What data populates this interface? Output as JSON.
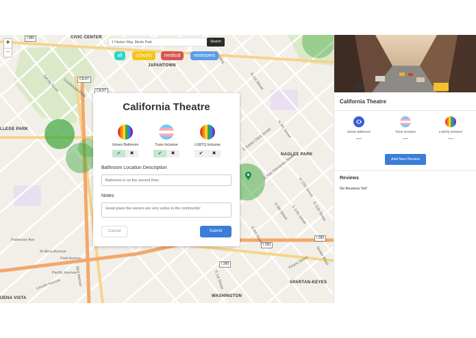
{
  "map": {
    "zoom_in": "+",
    "zoom_out": "−",
    "area_labels": [
      "CIVIC CENTER",
      "JAPANTOWN",
      "LLEGE PARK",
      "NAGLEE PARK",
      "SPARTAN-KEYES",
      "WASHINGTON",
      "UENA VISTA"
    ],
    "highway_shields": [
      "I 880",
      "CA 87",
      "CA 87",
      "I 280",
      "I 280",
      "I 280"
    ],
    "street_labels": [
      "Spring Street",
      "Guadalupe Pkwy",
      "N 1st Street",
      "N 4th Street",
      "N 10th Street",
      "S 11th Street",
      "S 4th Street",
      "W Alma Avenue",
      "Park Avenue",
      "Pacific Avenue",
      "Hedding",
      "E Santa Clara Street",
      "E San Fernando Street",
      "Keyes Street",
      "Senter Road",
      "S 6th Street",
      "S 1st Street",
      "Parkmoor Ave",
      "S 10th Street",
      "Bird Avenue",
      "Lincoln Avenue"
    ],
    "marker_icon": "map-pin-icon"
  },
  "search": {
    "value": "1 Hacker Way, Menlo Park",
    "button_label": "Search"
  },
  "filters": [
    {
      "label": "all",
      "color": "#2fd4c6",
      "text_color": "#ffffff"
    },
    {
      "label": "schools",
      "color": "#f5c518",
      "text_color": "#ffffff"
    },
    {
      "label": "medical",
      "color": "#d9534f",
      "text_color": "#ffffff"
    },
    {
      "label": "restrooms",
      "color": "#5b9ce8",
      "text_color": "#ffffff"
    }
  ],
  "modal": {
    "title": "California Theatre",
    "attributes": [
      {
        "label": "Unisex Bathroom",
        "icon": "rainbow-flag-icon",
        "selected": "yes"
      },
      {
        "label": "Trans Inclusive",
        "icon": "trans-flag-icon",
        "selected": "yes"
      },
      {
        "label": "LGBTQ Inclusive",
        "icon": "rainbow-flag-icon",
        "selected": "none"
      }
    ],
    "toggle_yes": "✔",
    "toggle_no": "✖",
    "location_label": "Bathroom Location Description",
    "location_value": "Bathroom is on the second floor.",
    "notes_label": "Notes",
    "notes_value": "Great place the owners are very active in the community!",
    "cancel_label": "Cancel",
    "submit_label": "Submit"
  },
  "sidebar": {
    "title": "California Theatre",
    "attributes": [
      {
        "label": "Unisex Bathroom",
        "value": "—",
        "icon": "bathroom-icon"
      },
      {
        "label": "Trans Inclusive",
        "value": "—",
        "icon": "trans-flag-icon"
      },
      {
        "label": "LGBTQ Inclusive",
        "value": "—",
        "icon": "rainbow-flag-icon"
      }
    ],
    "add_review_label": "Add New Review",
    "reviews_title": "Reviews",
    "reviews_empty": "No Reviews Yet!"
  },
  "colors": {
    "accent": "#3b7dd8",
    "rainbow": [
      "#e53935",
      "#fb8c00",
      "#fdd835",
      "#43a047",
      "#1e88e5",
      "#8e24aa"
    ],
    "trans": [
      "#5bcefa",
      "#f5a9b8",
      "#ffffff",
      "#f5a9b8",
      "#5bcefa"
    ]
  }
}
